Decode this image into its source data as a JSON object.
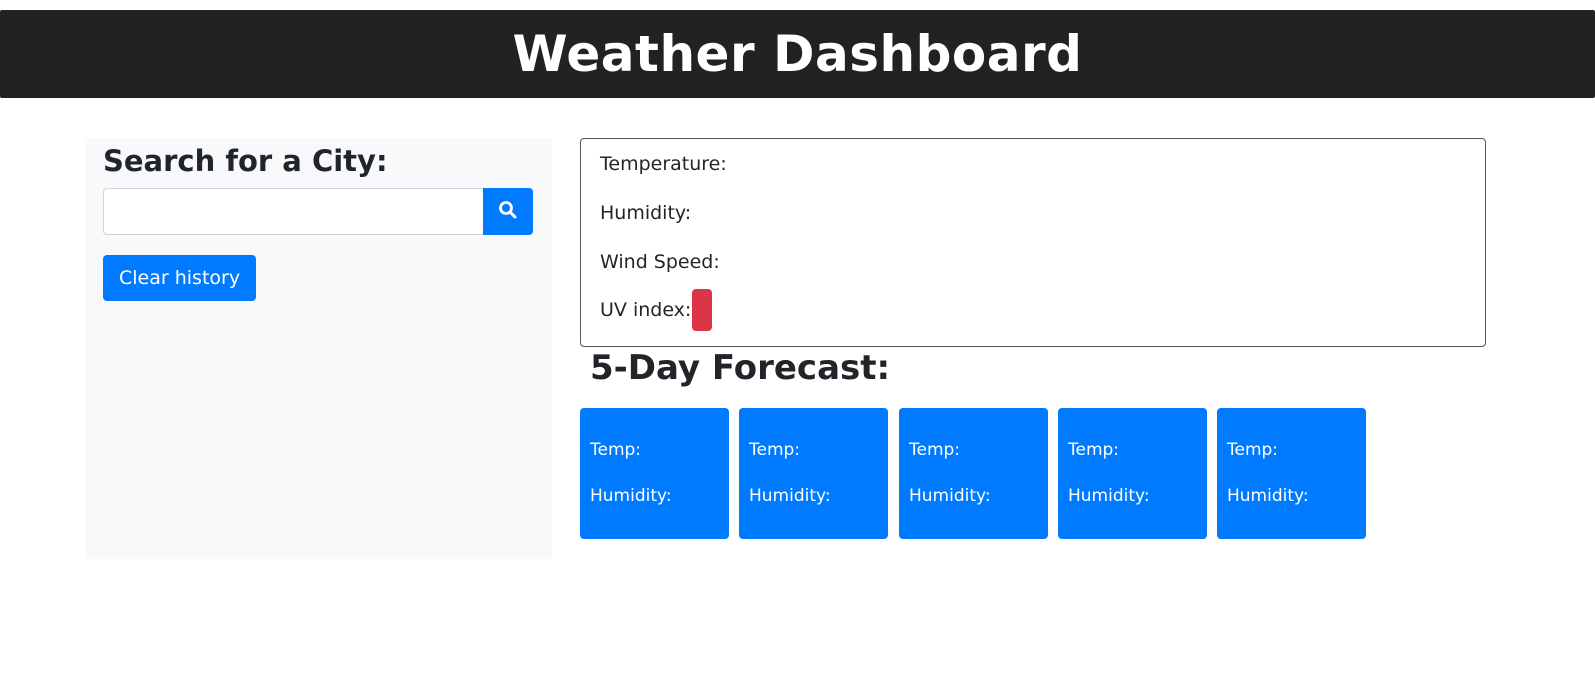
{
  "header": {
    "title": "Weather Dashboard"
  },
  "sidebar": {
    "heading": "Search for a City:",
    "search": {
      "value": "",
      "placeholder": ""
    },
    "search_button_icon": "search-icon",
    "clear_label": "Clear history"
  },
  "current": {
    "temperature_label": "Temperature:",
    "humidity_label": "Humidity:",
    "wind_label": "Wind Speed:",
    "uv_label": "UV index:",
    "uv_color": "#dc3545"
  },
  "forecast": {
    "title": "5-Day Forecast:",
    "cards": [
      {
        "temp_label": "Temp:",
        "humidity_label": "Humidity:"
      },
      {
        "temp_label": "Temp:",
        "humidity_label": "Humidity:"
      },
      {
        "temp_label": "Temp:",
        "humidity_label": "Humidity:"
      },
      {
        "temp_label": "Temp:",
        "humidity_label": "Humidity:"
      },
      {
        "temp_label": "Temp:",
        "humidity_label": "Humidity:"
      }
    ]
  },
  "colors": {
    "header_bg": "#222220",
    "accent": "#007bff",
    "sidebar_bg": "#f8f9fa",
    "danger": "#dc3545"
  }
}
